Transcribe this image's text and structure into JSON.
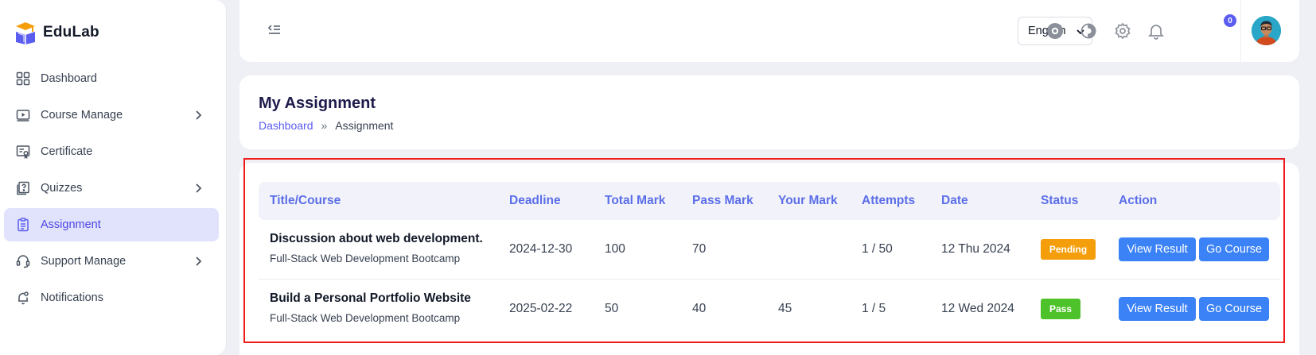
{
  "brand": {
    "name": "EduLab"
  },
  "sidebar": {
    "items": [
      {
        "label": "Dashboard",
        "icon": "grid-icon",
        "chevron": false,
        "active": false
      },
      {
        "label": "Course Manage",
        "icon": "video-icon",
        "chevron": true,
        "active": false
      },
      {
        "label": "Certificate",
        "icon": "certificate-icon",
        "chevron": false,
        "active": false
      },
      {
        "label": "Quizzes",
        "icon": "quiz-icon",
        "chevron": true,
        "active": false
      },
      {
        "label": "Assignment",
        "icon": "clipboard-icon",
        "chevron": false,
        "active": true
      },
      {
        "label": "Support Manage",
        "icon": "headset-icon",
        "chevron": true,
        "active": false
      },
      {
        "label": "Notifications",
        "icon": "bell-icon",
        "chevron": false,
        "active": false
      }
    ]
  },
  "topbar": {
    "language": "English",
    "notification_count": "0"
  },
  "page": {
    "title": "My Assignment",
    "breadcrumb": {
      "home": "Dashboard",
      "separator": "»",
      "current": "Assignment"
    }
  },
  "table": {
    "headers": [
      "Title/Course",
      "Deadline",
      "Total Mark",
      "Pass Mark",
      "Your Mark",
      "Attempts",
      "Date",
      "Status",
      "Action"
    ],
    "rows": [
      {
        "title": "Discussion about web development.",
        "course": "Full-Stack Web Development Bootcamp",
        "deadline": "2024-12-30",
        "total_mark": "100",
        "pass_mark": "70",
        "your_mark": "",
        "attempts": "1 / 50",
        "date": "12 Thu 2024",
        "status": "Pending",
        "view_label": "View Result",
        "go_label": "Go Course"
      },
      {
        "title": "Build a Personal Portfolio Website",
        "course": "Full-Stack Web Development Bootcamp",
        "deadline": "2025-02-22",
        "total_mark": "50",
        "pass_mark": "40",
        "your_mark": "45",
        "attempts": "1 / 5",
        "date": "12 Wed 2024",
        "status": "Pass",
        "view_label": "View Result",
        "go_label": "Go Course"
      }
    ]
  },
  "colors": {
    "accent": "#5b5cf0",
    "header_text": "#5b6ee8",
    "pending": "#f59e0b",
    "pass": "#4ec22a",
    "button": "#3b82f6",
    "highlight": "#ef1c1c"
  }
}
